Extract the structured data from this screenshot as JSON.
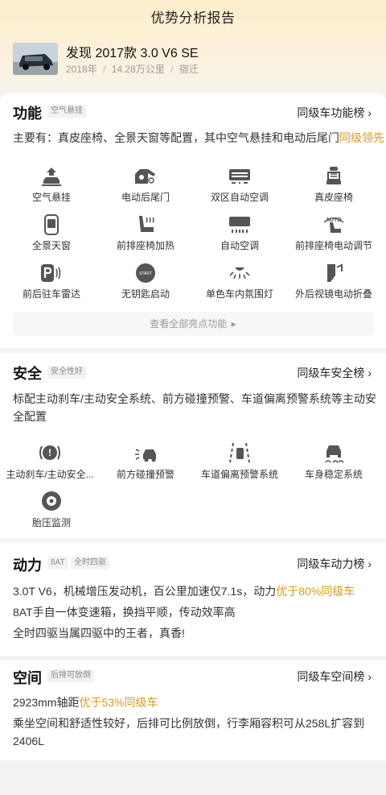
{
  "header": {
    "title": "优势分析报告"
  },
  "car": {
    "title": "发现 2017款 3.0 V6 SE",
    "year": "2018年",
    "mileage": "14.28万公里",
    "city": "宿迁",
    "sep": "/"
  },
  "function": {
    "title": "功能",
    "tag": "空气悬挂",
    "rank": "同级车功能榜",
    "desc_prefix": "主要有：真皮座椅、全景天窗等配置，其中空气悬挂和电动后尾门",
    "desc_highlight": "同级领先",
    "items": [
      "空气悬挂",
      "电动后尾门",
      "双区自动空调",
      "真皮座椅",
      "全景天窗",
      "前排座椅加热",
      "自动空调",
      "前排座椅电动调节",
      "前后驻车雷达",
      "无钥匙启动",
      "单色车内氛围灯",
      "外后视镜电动折叠"
    ],
    "more": "查看全部亮点功能",
    "more_arrow": "▸"
  },
  "safety": {
    "title": "安全",
    "tag": "安全性好",
    "rank": "同级车安全榜",
    "desc_line1": "标配主动刹车/主动安全系统、前方碰撞预警、车道偏离预警系统等主动安",
    "desc_line2": "全配置",
    "items": [
      "主动刹车/主动安全...",
      "前方碰撞预警",
      "车道偏离预警系统",
      "车身稳定系统",
      "胎压监测"
    ]
  },
  "power": {
    "title": "动力",
    "tags": [
      "8AT",
      "全时四驱"
    ],
    "rank": "同级车动力榜",
    "line1_prefix": "3.0T V6，机械增压发动机，百公里加速仅7.1s，动力",
    "line1_highlight": "优于80%同级车",
    "line2": "8AT手自一体变速箱，换挡平顺，传动效率高",
    "line3": "全时四驱当属四驱中的王者，真香!"
  },
  "space": {
    "title": "空间",
    "tag": "后排可放倒",
    "rank": "同级车空间榜",
    "line1_prefix": "2923mm轴距",
    "line1_highlight": "优于53%同级车",
    "line2a": "乘坐空间和舒适性较好，后排可比例放倒，行李厢容积可从258L扩容到",
    "line2b": "2406L"
  },
  "icons": {
    "chevron": "›",
    "brake_symbol": "!",
    "keyless_label": "START",
    "seat_adjust_label": "AUTO"
  },
  "colors": {
    "highlight": "#d99a1a",
    "icon": "#555555"
  }
}
